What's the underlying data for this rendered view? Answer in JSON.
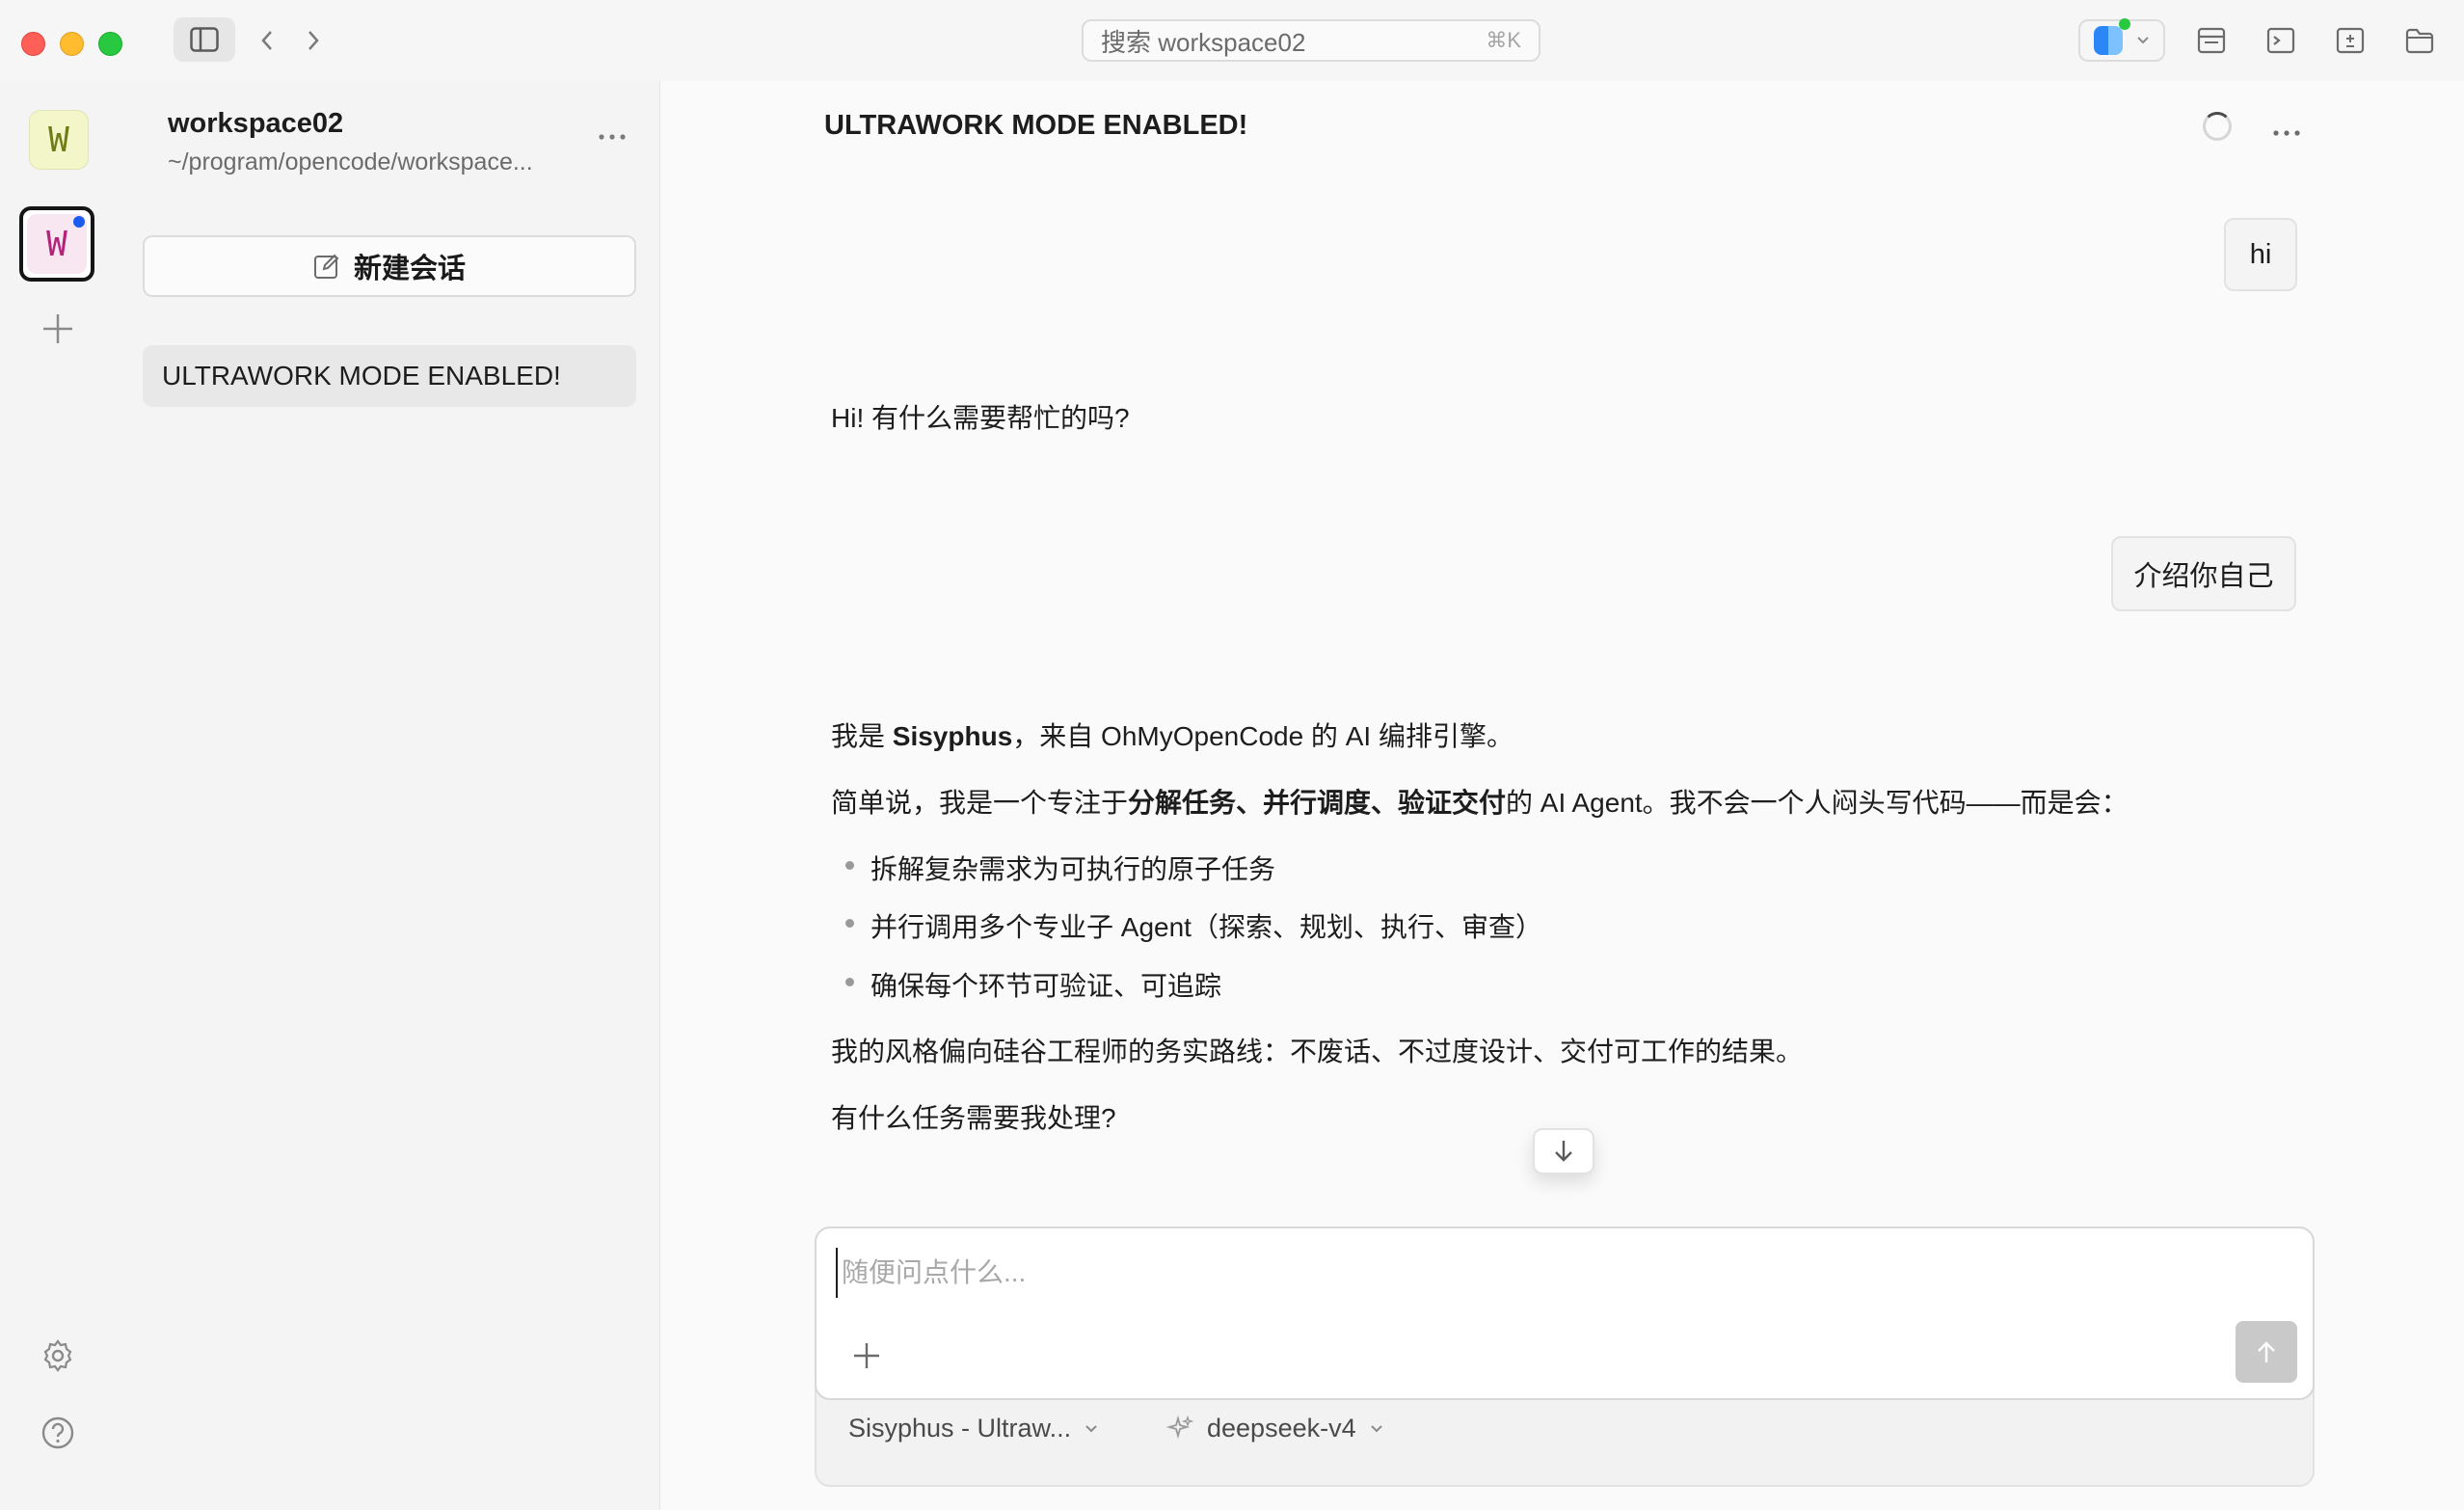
{
  "titlebar": {
    "search_placeholder": "搜索 workspace02",
    "search_shortcut": "⌘K"
  },
  "rail": {
    "workspaces": [
      {
        "letter": "W",
        "color": "#f2f6c9"
      },
      {
        "letter": "W",
        "color": "#f8e6f1",
        "active": true
      }
    ]
  },
  "sessions": {
    "workspace_name": "workspace02",
    "workspace_path": "~/program/opencode/workspace...",
    "new_session_label": "新建会话",
    "items": [
      {
        "title": "ULTRAWORK MODE ENABLED!"
      }
    ]
  },
  "chat": {
    "title": "ULTRAWORK MODE ENABLED!",
    "user_msg_1": "hi",
    "assistant_msg_1": "Hi! 有什么需要帮忙的吗?",
    "user_msg_2": "介绍你自己",
    "assistant_msg_2": {
      "p1_pre": "我是 ",
      "p1_bold": "Sisyphus",
      "p1_post": "，来自 OhMyOpenCode 的 AI 编排引擎。",
      "p2_pre": "简单说，我是一个专注于",
      "p2_bold": "分解任务、并行调度、验证交付",
      "p2_post": "的 AI Agent。我不会一个人闷头写代码——而是会：",
      "bullets": [
        "拆解复杂需求为可执行的原子任务",
        "并行调用多个专业子 Agent（探索、规划、执行、审查）",
        "确保每个环节可验证、可追踪"
      ],
      "p3": "我的风格偏向硅谷工程师的务实路线：不废话、不过度设计、交付可工作的结果。",
      "p4": "有什么任务需要我处理?"
    }
  },
  "composer": {
    "placeholder": "随便问点什么...",
    "agent_label": "Sisyphus - Ultraw...",
    "model_label": "deepseek-v4"
  }
}
